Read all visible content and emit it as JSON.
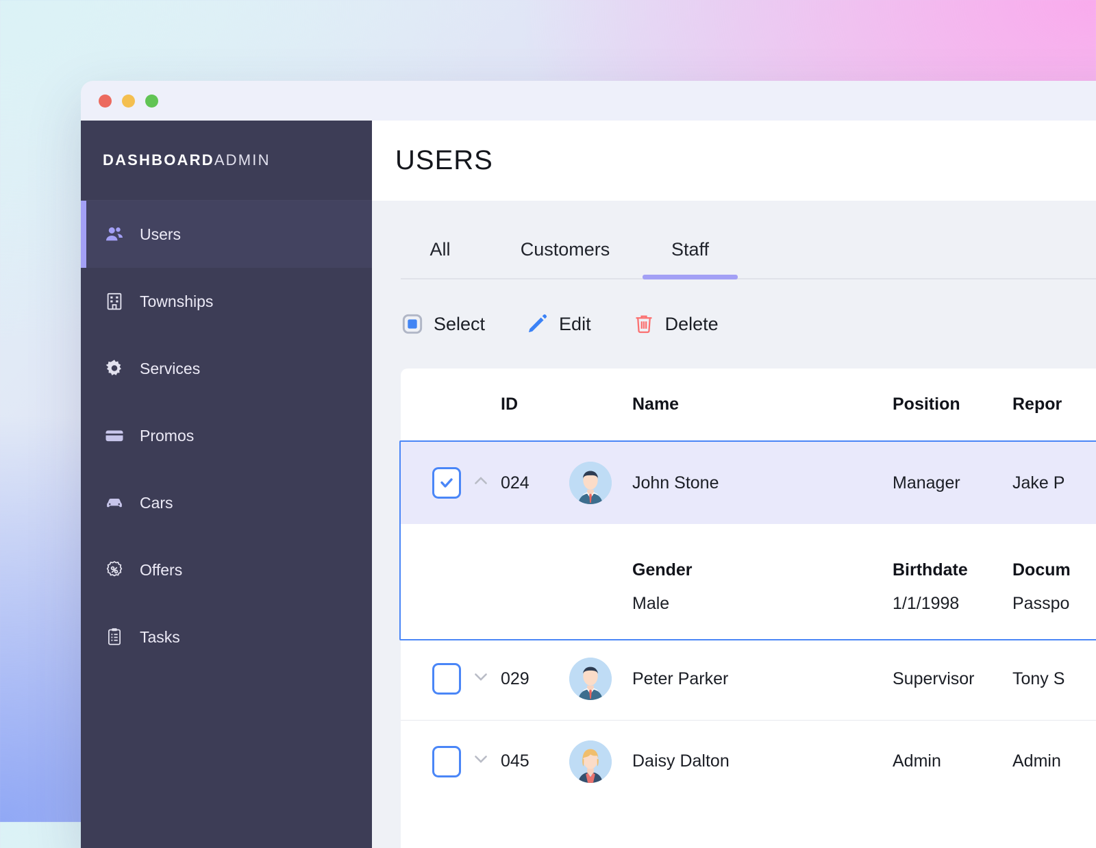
{
  "window": {
    "traffic_lights": [
      {
        "name": "close",
        "color": "#ec6a5e"
      },
      {
        "name": "minimize",
        "color": "#f4bf4f"
      },
      {
        "name": "zoom",
        "color": "#61c454"
      }
    ]
  },
  "sidebar": {
    "brand_bold": "DASHBOARD",
    "brand_light": "ADMIN",
    "items": [
      {
        "label": "Users",
        "icon": "users-icon",
        "active": true
      },
      {
        "label": "Townships",
        "icon": "building-icon",
        "active": false
      },
      {
        "label": "Services",
        "icon": "gear-icon",
        "active": false
      },
      {
        "label": "Promos",
        "icon": "card-icon",
        "active": false
      },
      {
        "label": "Cars",
        "icon": "car-icon",
        "active": false
      },
      {
        "label": "Offers",
        "icon": "percent-badge-icon",
        "active": false
      },
      {
        "label": "Tasks",
        "icon": "clipboard-icon",
        "active": false
      }
    ]
  },
  "header": {
    "title": "USERS"
  },
  "tabs": {
    "items": [
      {
        "label": "All",
        "active": false
      },
      {
        "label": "Customers",
        "active": false
      },
      {
        "label": "Staff",
        "active": true
      }
    ],
    "active_underline_color": "#a3a0f5"
  },
  "toolbar": {
    "select_label": "Select",
    "edit_label": "Edit",
    "delete_label": "Delete",
    "select_color": "#4285f4",
    "edit_color": "#3b82f6",
    "delete_color": "#fb7070"
  },
  "table": {
    "columns": {
      "id": "ID",
      "name": "Name",
      "position": "Position",
      "reports_to": "Repor"
    },
    "detail_columns": {
      "gender": "Gender",
      "birthdate": "Birthdate",
      "document": "Docum"
    },
    "rows": [
      {
        "id": "024",
        "name": "John Stone",
        "position": "Manager",
        "reports_to": "Jake P",
        "checked": true,
        "expanded": true,
        "chevron": "chevron-up-icon",
        "avatar": "male-dark-hair",
        "detail": {
          "gender": "Male",
          "birthdate": "1/1/1998",
          "document": "Passpo"
        }
      },
      {
        "id": "029",
        "name": "Peter Parker",
        "position": "Supervisor",
        "reports_to": "Tony S",
        "checked": false,
        "expanded": false,
        "chevron": "chevron-down-icon",
        "avatar": "male-dark-hair",
        "detail": null
      },
      {
        "id": "045",
        "name": "Daisy Dalton",
        "position": "Admin",
        "reports_to": "Admin",
        "checked": false,
        "expanded": false,
        "chevron": "chevron-down-icon",
        "avatar": "female-blonde",
        "detail": null
      }
    ]
  },
  "colors": {
    "sidebar_bg": "#3d3d56",
    "sidebar_active_bg": "#434360",
    "accent_purple": "#a3a0f5",
    "accent_blue": "#4a86f7",
    "selected_row_bg": "#e9e9fb",
    "content_bg": "#eff1f6"
  }
}
